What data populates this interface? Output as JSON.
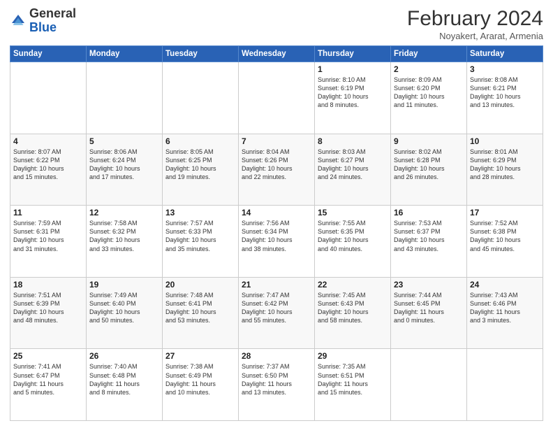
{
  "header": {
    "logo_line1": "General",
    "logo_line2": "Blue",
    "month_year": "February 2024",
    "location": "Noyakert, Ararat, Armenia"
  },
  "days_of_week": [
    "Sunday",
    "Monday",
    "Tuesday",
    "Wednesday",
    "Thursday",
    "Friday",
    "Saturday"
  ],
  "weeks": [
    [
      {
        "day": "",
        "info": ""
      },
      {
        "day": "",
        "info": ""
      },
      {
        "day": "",
        "info": ""
      },
      {
        "day": "",
        "info": ""
      },
      {
        "day": "1",
        "info": "Sunrise: 8:10 AM\nSunset: 6:19 PM\nDaylight: 10 hours\nand 8 minutes."
      },
      {
        "day": "2",
        "info": "Sunrise: 8:09 AM\nSunset: 6:20 PM\nDaylight: 10 hours\nand 11 minutes."
      },
      {
        "day": "3",
        "info": "Sunrise: 8:08 AM\nSunset: 6:21 PM\nDaylight: 10 hours\nand 13 minutes."
      }
    ],
    [
      {
        "day": "4",
        "info": "Sunrise: 8:07 AM\nSunset: 6:22 PM\nDaylight: 10 hours\nand 15 minutes."
      },
      {
        "day": "5",
        "info": "Sunrise: 8:06 AM\nSunset: 6:24 PM\nDaylight: 10 hours\nand 17 minutes."
      },
      {
        "day": "6",
        "info": "Sunrise: 8:05 AM\nSunset: 6:25 PM\nDaylight: 10 hours\nand 19 minutes."
      },
      {
        "day": "7",
        "info": "Sunrise: 8:04 AM\nSunset: 6:26 PM\nDaylight: 10 hours\nand 22 minutes."
      },
      {
        "day": "8",
        "info": "Sunrise: 8:03 AM\nSunset: 6:27 PM\nDaylight: 10 hours\nand 24 minutes."
      },
      {
        "day": "9",
        "info": "Sunrise: 8:02 AM\nSunset: 6:28 PM\nDaylight: 10 hours\nand 26 minutes."
      },
      {
        "day": "10",
        "info": "Sunrise: 8:01 AM\nSunset: 6:29 PM\nDaylight: 10 hours\nand 28 minutes."
      }
    ],
    [
      {
        "day": "11",
        "info": "Sunrise: 7:59 AM\nSunset: 6:31 PM\nDaylight: 10 hours\nand 31 minutes."
      },
      {
        "day": "12",
        "info": "Sunrise: 7:58 AM\nSunset: 6:32 PM\nDaylight: 10 hours\nand 33 minutes."
      },
      {
        "day": "13",
        "info": "Sunrise: 7:57 AM\nSunset: 6:33 PM\nDaylight: 10 hours\nand 35 minutes."
      },
      {
        "day": "14",
        "info": "Sunrise: 7:56 AM\nSunset: 6:34 PM\nDaylight: 10 hours\nand 38 minutes."
      },
      {
        "day": "15",
        "info": "Sunrise: 7:55 AM\nSunset: 6:35 PM\nDaylight: 10 hours\nand 40 minutes."
      },
      {
        "day": "16",
        "info": "Sunrise: 7:53 AM\nSunset: 6:37 PM\nDaylight: 10 hours\nand 43 minutes."
      },
      {
        "day": "17",
        "info": "Sunrise: 7:52 AM\nSunset: 6:38 PM\nDaylight: 10 hours\nand 45 minutes."
      }
    ],
    [
      {
        "day": "18",
        "info": "Sunrise: 7:51 AM\nSunset: 6:39 PM\nDaylight: 10 hours\nand 48 minutes."
      },
      {
        "day": "19",
        "info": "Sunrise: 7:49 AM\nSunset: 6:40 PM\nDaylight: 10 hours\nand 50 minutes."
      },
      {
        "day": "20",
        "info": "Sunrise: 7:48 AM\nSunset: 6:41 PM\nDaylight: 10 hours\nand 53 minutes."
      },
      {
        "day": "21",
        "info": "Sunrise: 7:47 AM\nSunset: 6:42 PM\nDaylight: 10 hours\nand 55 minutes."
      },
      {
        "day": "22",
        "info": "Sunrise: 7:45 AM\nSunset: 6:43 PM\nDaylight: 10 hours\nand 58 minutes."
      },
      {
        "day": "23",
        "info": "Sunrise: 7:44 AM\nSunset: 6:45 PM\nDaylight: 11 hours\nand 0 minutes."
      },
      {
        "day": "24",
        "info": "Sunrise: 7:43 AM\nSunset: 6:46 PM\nDaylight: 11 hours\nand 3 minutes."
      }
    ],
    [
      {
        "day": "25",
        "info": "Sunrise: 7:41 AM\nSunset: 6:47 PM\nDaylight: 11 hours\nand 5 minutes."
      },
      {
        "day": "26",
        "info": "Sunrise: 7:40 AM\nSunset: 6:48 PM\nDaylight: 11 hours\nand 8 minutes."
      },
      {
        "day": "27",
        "info": "Sunrise: 7:38 AM\nSunset: 6:49 PM\nDaylight: 11 hours\nand 10 minutes."
      },
      {
        "day": "28",
        "info": "Sunrise: 7:37 AM\nSunset: 6:50 PM\nDaylight: 11 hours\nand 13 minutes."
      },
      {
        "day": "29",
        "info": "Sunrise: 7:35 AM\nSunset: 6:51 PM\nDaylight: 11 hours\nand 15 minutes."
      },
      {
        "day": "",
        "info": ""
      },
      {
        "day": "",
        "info": ""
      }
    ]
  ]
}
